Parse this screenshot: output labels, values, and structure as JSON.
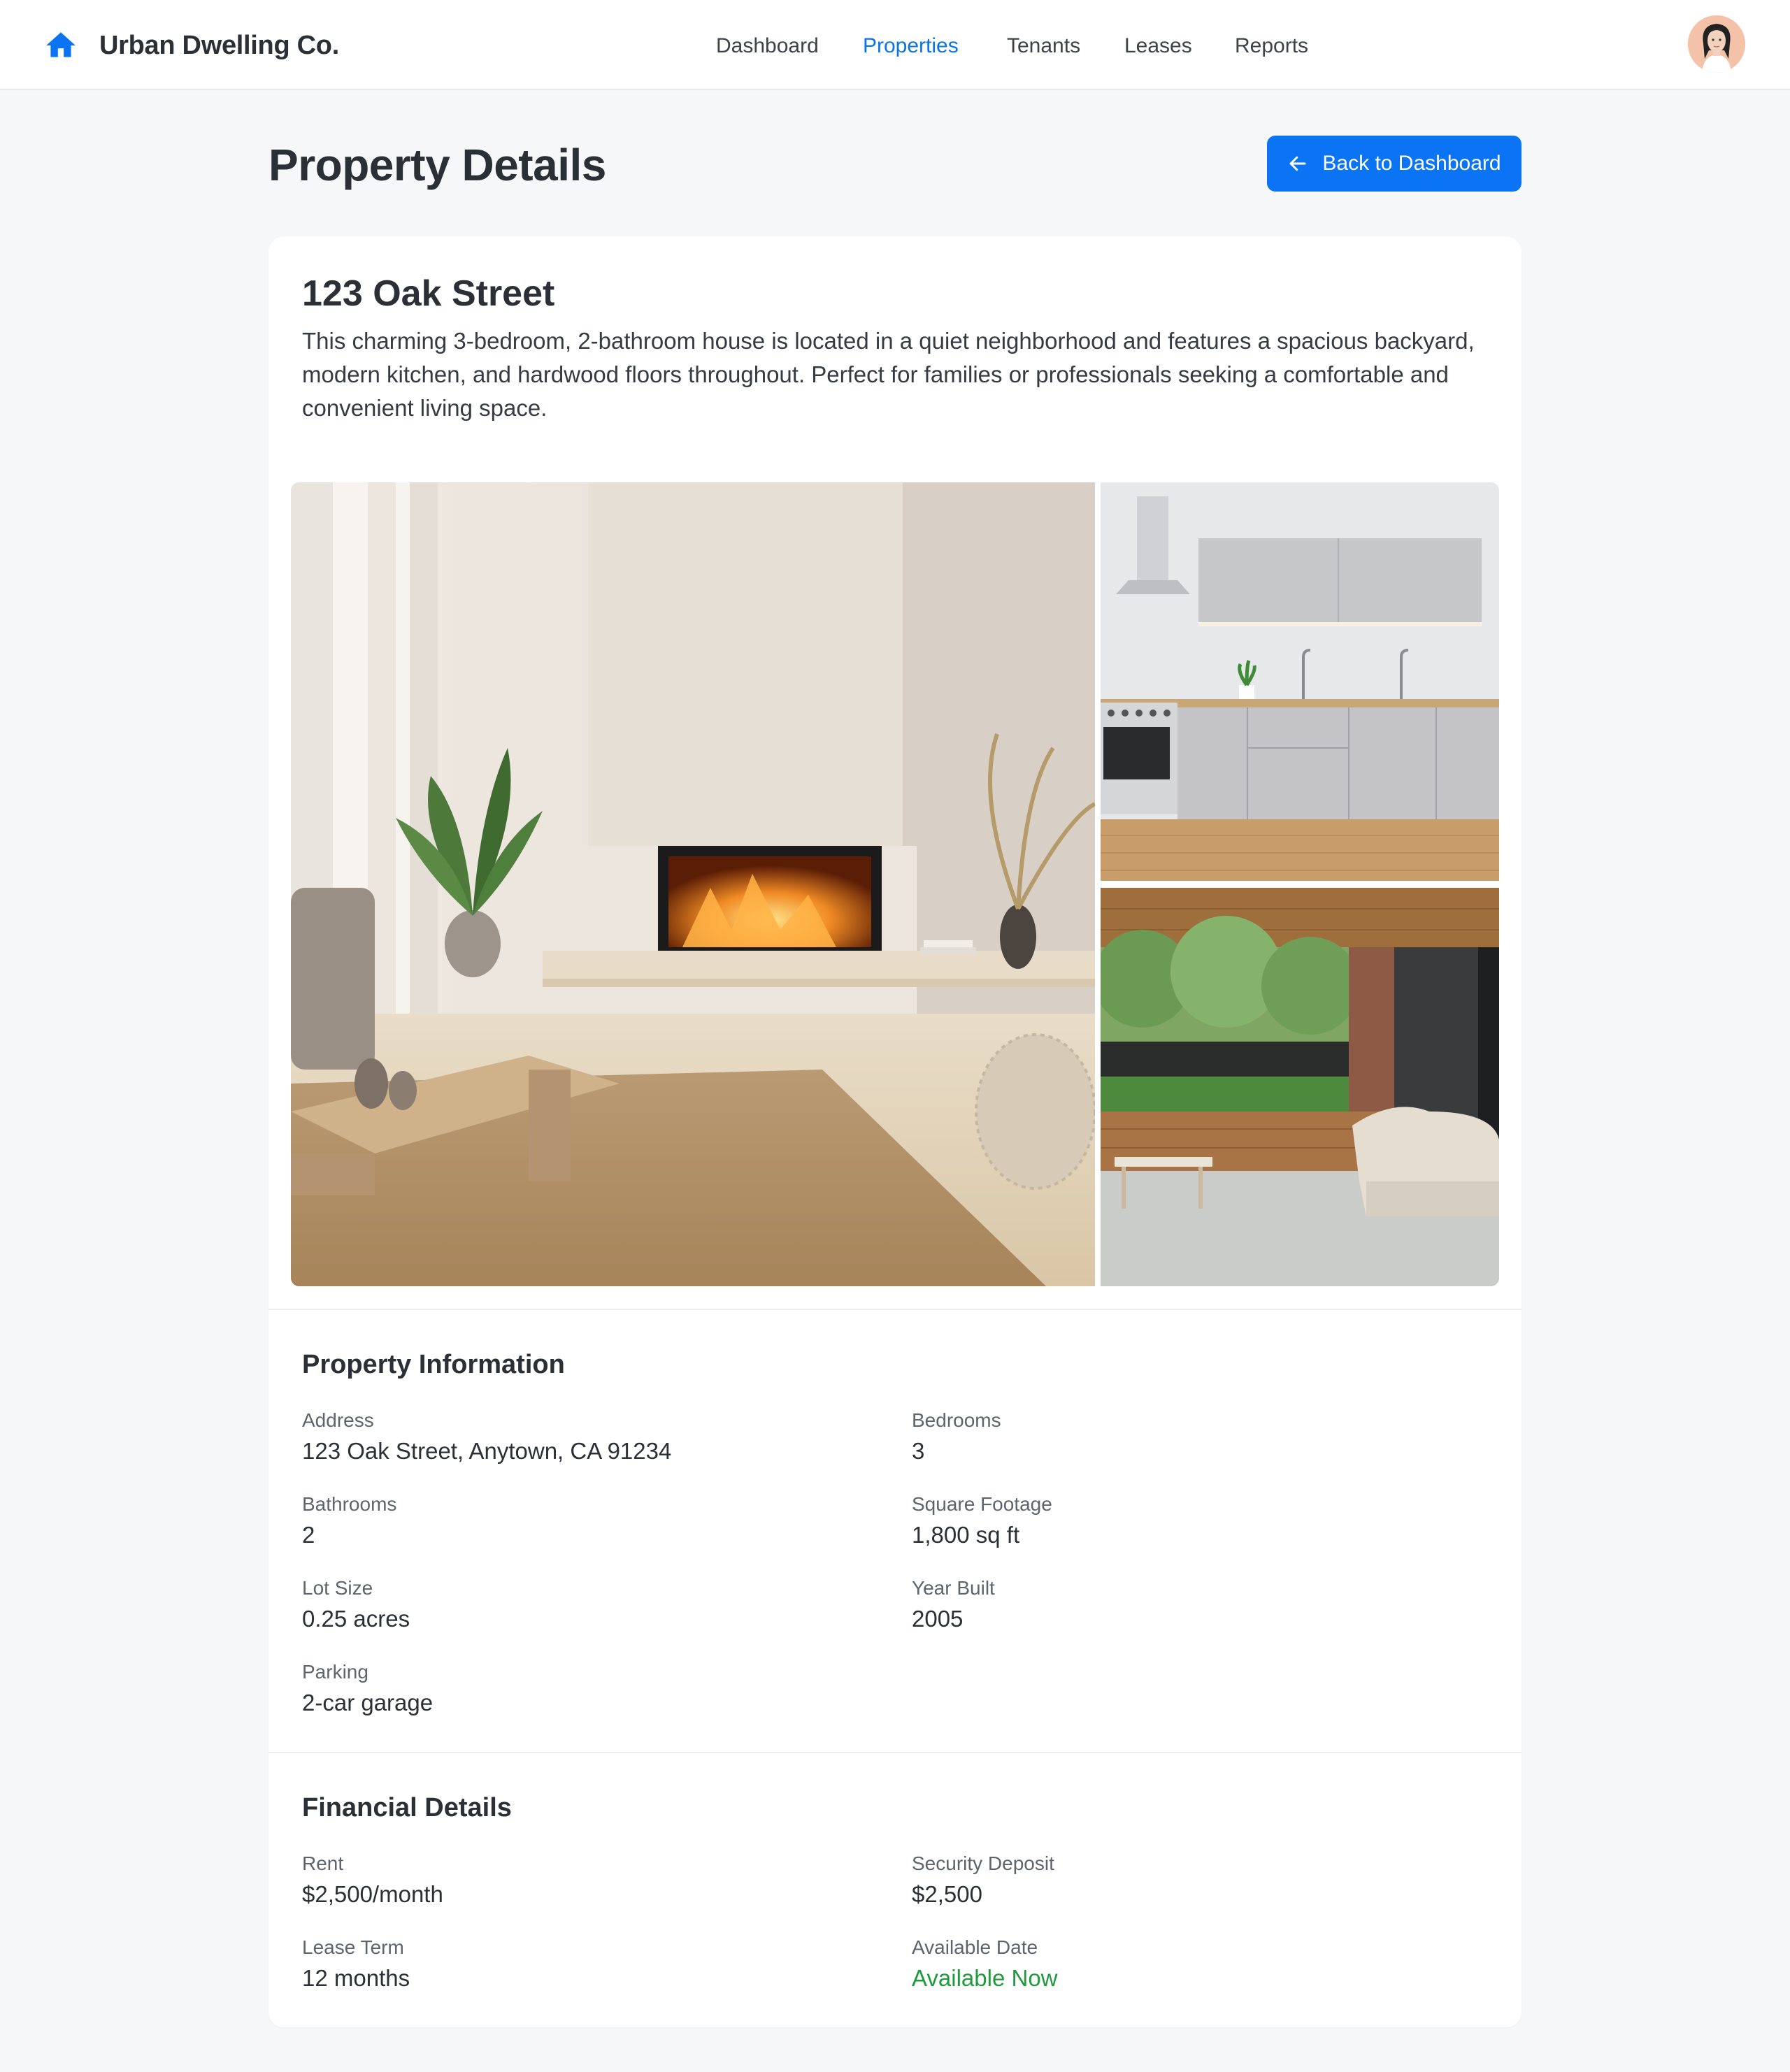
{
  "app": {
    "brand": "Urban Dwelling Co.",
    "brand_icon": "home-icon",
    "accent_color": "#0a74f5"
  },
  "nav": {
    "items": [
      {
        "label": "Dashboard",
        "active": false
      },
      {
        "label": "Properties",
        "active": true
      },
      {
        "label": "Tenants",
        "active": false
      },
      {
        "label": "Leases",
        "active": false
      },
      {
        "label": "Reports",
        "active": false
      }
    ],
    "avatar_icon": "user-avatar"
  },
  "header": {
    "title": "Property Details",
    "back_button_label": "Back to Dashboard",
    "back_button_icon": "arrow-left-icon"
  },
  "property": {
    "name": "123 Oak Street",
    "description": "This charming 3-bedroom, 2-bathroom house is located in a quiet neighborhood and features a spacious backyard, modern kitchen, and hardwood floors throughout. Perfect for families or professionals seeking a comfortable and convenient living space."
  },
  "info": {
    "title": "Property Information",
    "fields": [
      {
        "label": "Address",
        "value": "123 Oak Street, Anytown, CA 91234"
      },
      {
        "label": "Bedrooms",
        "value": "3"
      },
      {
        "label": "Bathrooms",
        "value": "2"
      },
      {
        "label": "Square Footage",
        "value": "1,800 sq ft"
      },
      {
        "label": "Lot Size",
        "value": "0.25 acres"
      },
      {
        "label": "Year Built",
        "value": "2005"
      },
      {
        "label": "Parking",
        "value": "2-car garage"
      }
    ]
  },
  "financial": {
    "title": "Financial Details",
    "fields": [
      {
        "label": "Rent",
        "value": "$2,500/month"
      },
      {
        "label": "Security Deposit",
        "value": "$2,500"
      },
      {
        "label": "Lease Term",
        "value": "12 months"
      },
      {
        "label": "Available Date",
        "value": "Available Now",
        "color": "#1f9a3d"
      }
    ]
  }
}
